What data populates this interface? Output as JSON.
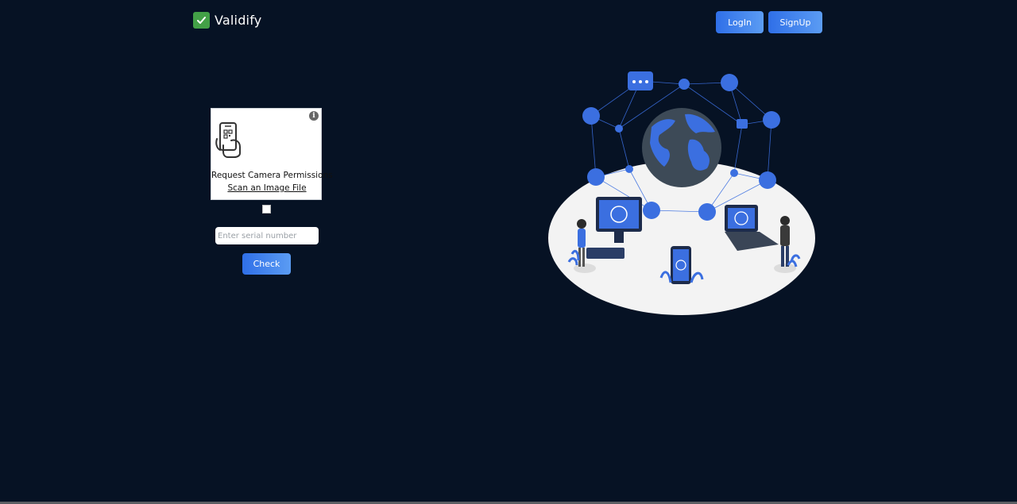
{
  "header": {
    "brand_name": "Validify",
    "login_label": "LogIn",
    "signup_label": "SignUp"
  },
  "scanner": {
    "request_label": "Request Camera Permissions",
    "scan_file_label": "Scan an Image File"
  },
  "serial": {
    "placeholder": "Enter serial number",
    "check_label": "Check"
  },
  "colors": {
    "background": "#061224",
    "accent": "#2f6fe8",
    "brand_check": "#43a047"
  }
}
